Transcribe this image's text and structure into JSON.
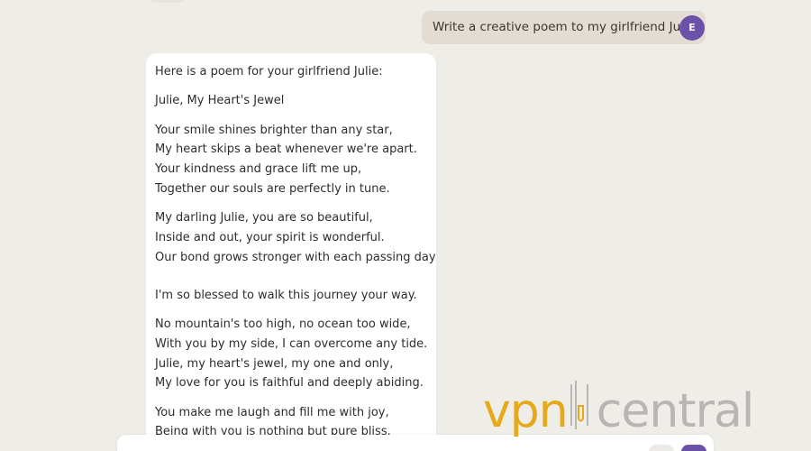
{
  "user_message": {
    "text": "Write a creative poem to my girlfriend Julie",
    "avatar_initial": "E"
  },
  "bot_message": {
    "intro": "Here is a poem for your girlfriend Julie:",
    "title": "Julie, My Heart's Jewel",
    "stanza1": [
      "Your smile shines brighter than any star,",
      "My heart skips a beat whenever we're apart.",
      "Your kindness and grace lift me up,",
      "Together our souls are perfectly in tune."
    ],
    "stanza2": [
      "My darling Julie, you are so beautiful,",
      "Inside and out, your spirit is wonderful.",
      "Our bond grows stronger with each passing day,"
    ],
    "stanza2_end": "I'm so blessed to walk this journey your way.",
    "stanza3": [
      "No mountain's too high, no ocean too wide,",
      "With you by my side, I can overcome any tide.",
      "Julie, my heart's jewel, my one and only,",
      "My love for you is faithful and deeply abiding."
    ],
    "stanza4": [
      "You make me laugh and fill me with joy,",
      "Being with you is nothing but pure bliss."
    ]
  },
  "watermark": {
    "part1": "vpn",
    "part2": "central"
  },
  "colors": {
    "background": "#efede8",
    "user_bubble": "#e3dcd2",
    "accent": "#6b52a8",
    "watermark_orange": "#e6a91c",
    "watermark_gray": "#b8b6b3"
  }
}
